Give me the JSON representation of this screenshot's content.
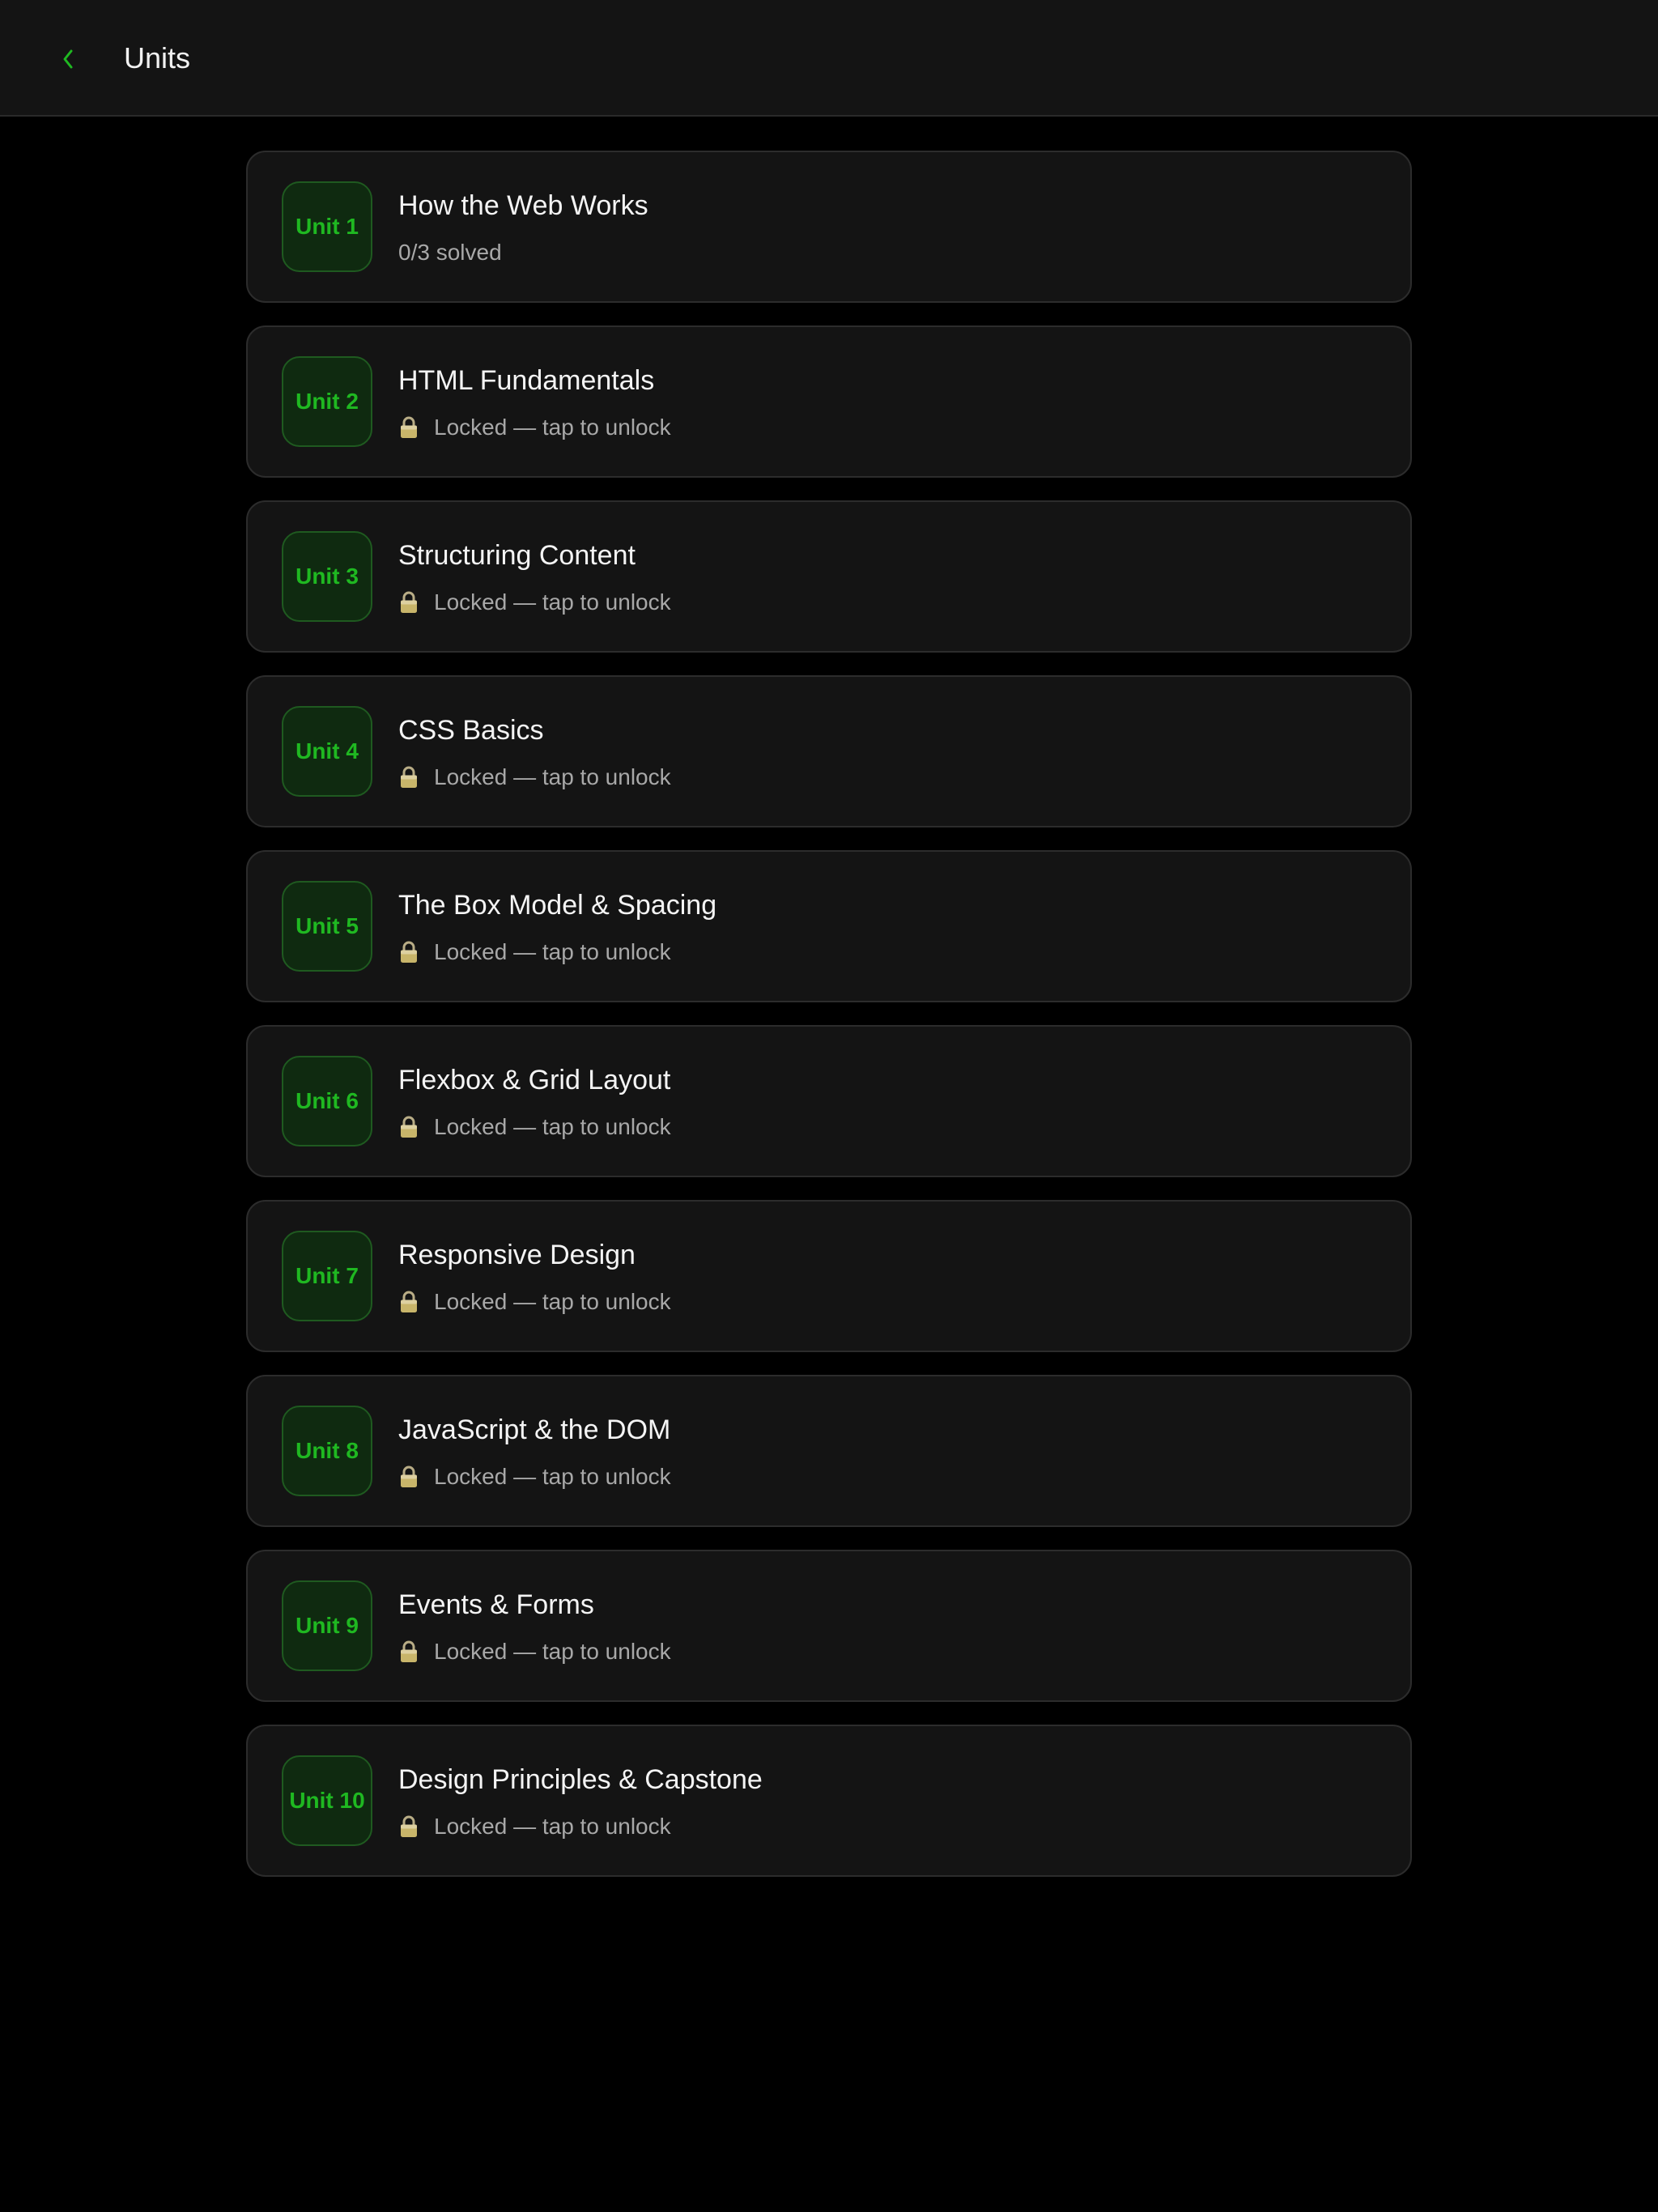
{
  "header": {
    "title": "Units",
    "back_icon": "chevron-left-icon"
  },
  "colors": {
    "accent": "#1fb821",
    "background": "#000000",
    "card": "#141414",
    "lock": "#c8b56a"
  },
  "units": [
    {
      "badge": "Unit 1",
      "title": "How the Web Works",
      "status": "0/3 solved",
      "locked": false
    },
    {
      "badge": "Unit 2",
      "title": "HTML Fundamentals",
      "status": "Locked — tap to unlock",
      "locked": true
    },
    {
      "badge": "Unit 3",
      "title": "Structuring Content",
      "status": "Locked — tap to unlock",
      "locked": true
    },
    {
      "badge": "Unit 4",
      "title": "CSS Basics",
      "status": "Locked — tap to unlock",
      "locked": true
    },
    {
      "badge": "Unit 5",
      "title": "The Box Model & Spacing",
      "status": "Locked — tap to unlock",
      "locked": true
    },
    {
      "badge": "Unit 6",
      "title": "Flexbox & Grid Layout",
      "status": "Locked — tap to unlock",
      "locked": true
    },
    {
      "badge": "Unit 7",
      "title": "Responsive Design",
      "status": "Locked — tap to unlock",
      "locked": true
    },
    {
      "badge": "Unit 8",
      "title": "JavaScript & the DOM",
      "status": "Locked — tap to unlock",
      "locked": true
    },
    {
      "badge": "Unit 9",
      "title": "Events & Forms",
      "status": "Locked — tap to unlock",
      "locked": true
    },
    {
      "badge": "Unit 10",
      "title": "Design Principles & Capstone",
      "status": "Locked — tap to unlock",
      "locked": true
    }
  ]
}
